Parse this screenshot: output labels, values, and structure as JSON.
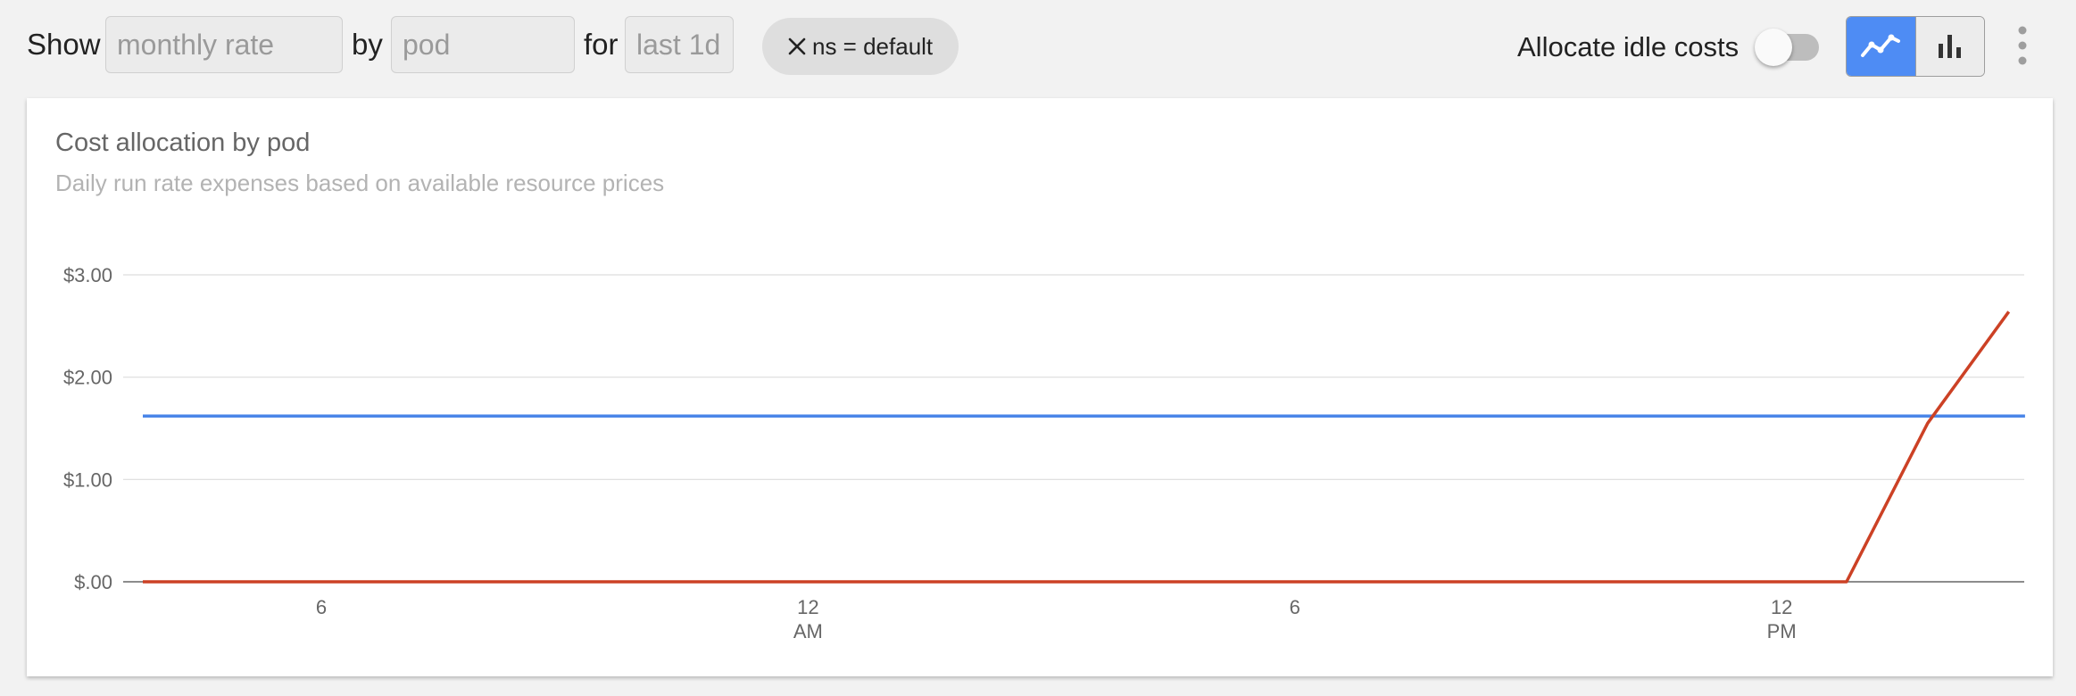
{
  "toolbar": {
    "show_label": "Show",
    "show_placeholder": "monthly rate",
    "by_label": "by",
    "by_placeholder": "pod",
    "for_label": "for",
    "for_placeholder": "last 1d",
    "filter_chip": "ns = default",
    "idle_label": "Allocate idle costs",
    "idle_enabled": false,
    "view_mode": "line"
  },
  "icons": {
    "chip_remove": "close-icon",
    "line_view": "line-chart-icon",
    "bar_view": "bar-chart-icon",
    "menu": "more-vert-icon"
  },
  "colors": {
    "accent": "#4e8cf4",
    "series_blue": "#4a86e8",
    "series_red": "#cc4125"
  },
  "card": {
    "title": "Cost allocation by pod",
    "subtitle": "Daily run rate expenses based on available resource prices"
  },
  "chart_data": {
    "type": "line",
    "title": "Cost allocation by pod",
    "subtitle": "Daily run rate expenses based on available resource prices",
    "xlabel": "",
    "ylabel": "",
    "ylim": [
      0,
      3
    ],
    "yticks": [
      "$.00",
      "$1.00",
      "$2.00",
      "$3.00"
    ],
    "xlim": [
      2.35,
      16.55
    ],
    "xticks": [
      {
        "hour": 6,
        "label": "6",
        "sub": ""
      },
      {
        "hour": 12,
        "label": "12",
        "sub": "AM"
      },
      {
        "hour": 18,
        "label": "6",
        "sub": ""
      },
      {
        "hour": 24,
        "label": "12",
        "sub": "PM"
      }
    ],
    "grid": true,
    "legend": "none",
    "series": [
      {
        "color": "#4a86e8",
        "points": [
          [
            3.8,
            1.62
          ],
          [
            27.0,
            1.62
          ]
        ]
      },
      {
        "color": "#cc4125",
        "points": [
          [
            3.8,
            0.0
          ],
          [
            24.8,
            0.0
          ],
          [
            25.8,
            1.55
          ],
          [
            26.8,
            2.64
          ]
        ]
      }
    ]
  }
}
